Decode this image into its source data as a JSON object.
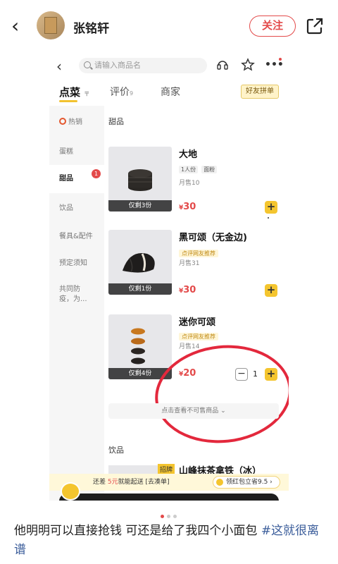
{
  "post": {
    "author": "张铭轩",
    "follow_label": "关注",
    "caption_text": "他明明可以直接抢钱 可还是给了我四个小面包 ",
    "caption_hashtag": "#这就很离谱"
  },
  "app": {
    "search_placeholder": "请输入商品名",
    "tabs": [
      {
        "label": "点菜",
        "sub": "〒"
      },
      {
        "label": "评价",
        "sub": "9"
      },
      {
        "label": "商家",
        "sub": ""
      }
    ],
    "group_button": "好友拼单",
    "sidebar": [
      {
        "label": "热销"
      },
      {
        "label": "蛋糕"
      },
      {
        "label": "甜品",
        "badge": "1"
      },
      {
        "label": "饮品"
      },
      {
        "label": "餐具&配件"
      },
      {
        "label": "预定须知"
      },
      {
        "label": "共同防疫，为..."
      }
    ],
    "section_dessert": "甜品",
    "section_drinks": "饮品",
    "items": [
      {
        "name": "大地",
        "tags": [
          "1人份",
          "面粉"
        ],
        "sold": "月售10",
        "price": "30",
        "stock": "仅剩3份"
      },
      {
        "name": "黑可颂（无金边)",
        "rec": "点评网友推荐",
        "sold": "月售31",
        "price": "30",
        "stock": "仅剩1份"
      },
      {
        "name": "迷你可颂",
        "rec": "点评网友推荐",
        "sold": "月售14",
        "price": "20",
        "stock": "仅剩4份",
        "qty": "1"
      }
    ],
    "view_more": "点击查看不可售商品 ⌄",
    "partial_item": {
      "badge": "招牌",
      "name": "山峰抹茶拿铁（冰）"
    },
    "bottom": {
      "pre": "还差",
      "amount": "5元",
      "post": "就能起送",
      "link": "[去凑单]",
      "coupon": "领红包立省9.5 ›"
    },
    "currency": "¥",
    "plus": "+",
    "minus": "−"
  }
}
